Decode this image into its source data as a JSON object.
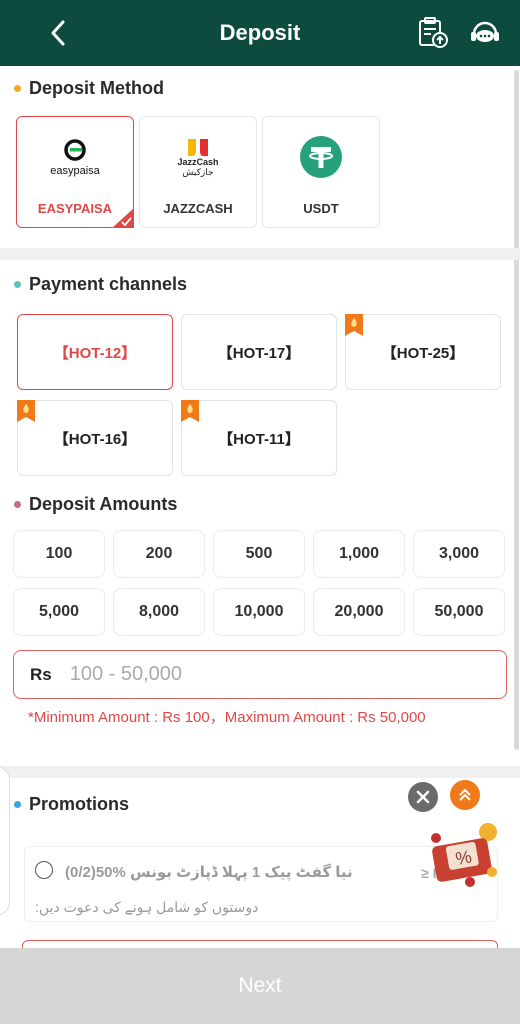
{
  "header": {
    "title": "Deposit"
  },
  "sections": {
    "deposit_method": "Deposit Method",
    "payment_channels": "Payment channels",
    "deposit_amounts": "Deposit Amounts",
    "promotions": "Promotions"
  },
  "methods": [
    {
      "logo_text": "easypaisa",
      "label": "EASYPAISA",
      "selected": true
    },
    {
      "logo_text": "JazzCash",
      "logo_text2": "جازکیش",
      "label": "JAZZCASH",
      "selected": false
    },
    {
      "logo_text": "",
      "label": "USDT",
      "selected": false
    }
  ],
  "channels": [
    {
      "label": "【HOT-12】",
      "selected": true,
      "hot_badge": false
    },
    {
      "label": "【HOT-17】",
      "selected": false,
      "hot_badge": false
    },
    {
      "label": "【HOT-25】",
      "selected": false,
      "hot_badge": true
    },
    {
      "label": "【HOT-16】",
      "selected": false,
      "hot_badge": true
    },
    {
      "label": "【HOT-11】",
      "selected": false,
      "hot_badge": true
    }
  ],
  "amounts": [
    "100",
    "200",
    "500",
    "1,000",
    "3,000",
    "5,000",
    "8,000",
    "10,000",
    "20,000",
    "50,000"
  ],
  "amount_input": {
    "currency": "Rs",
    "placeholder": "100 - 50,000",
    "value": ""
  },
  "limit_text": "*Minimum Amount : Rs 100，Maximum Amount : Rs 50,000",
  "promotion": {
    "title_line": "(0/2)50% نیا گفٹ پیک 1 پہلا ڈپازٹ بونس",
    "subtitle_line": ":دوستوں کو شامل ہونے کی دعوت دیں",
    "badge": "≥ Rs"
  },
  "next_label": "Next",
  "colors": {
    "header_bg": "#0d4b3f",
    "accent_red": "#e04848",
    "dot_orange": "#f5a623",
    "dot_teal": "#5cc3b8",
    "dot_pink": "#c86a82",
    "dot_blue": "#35a8e0",
    "next_bg": "#d6d6d6"
  }
}
